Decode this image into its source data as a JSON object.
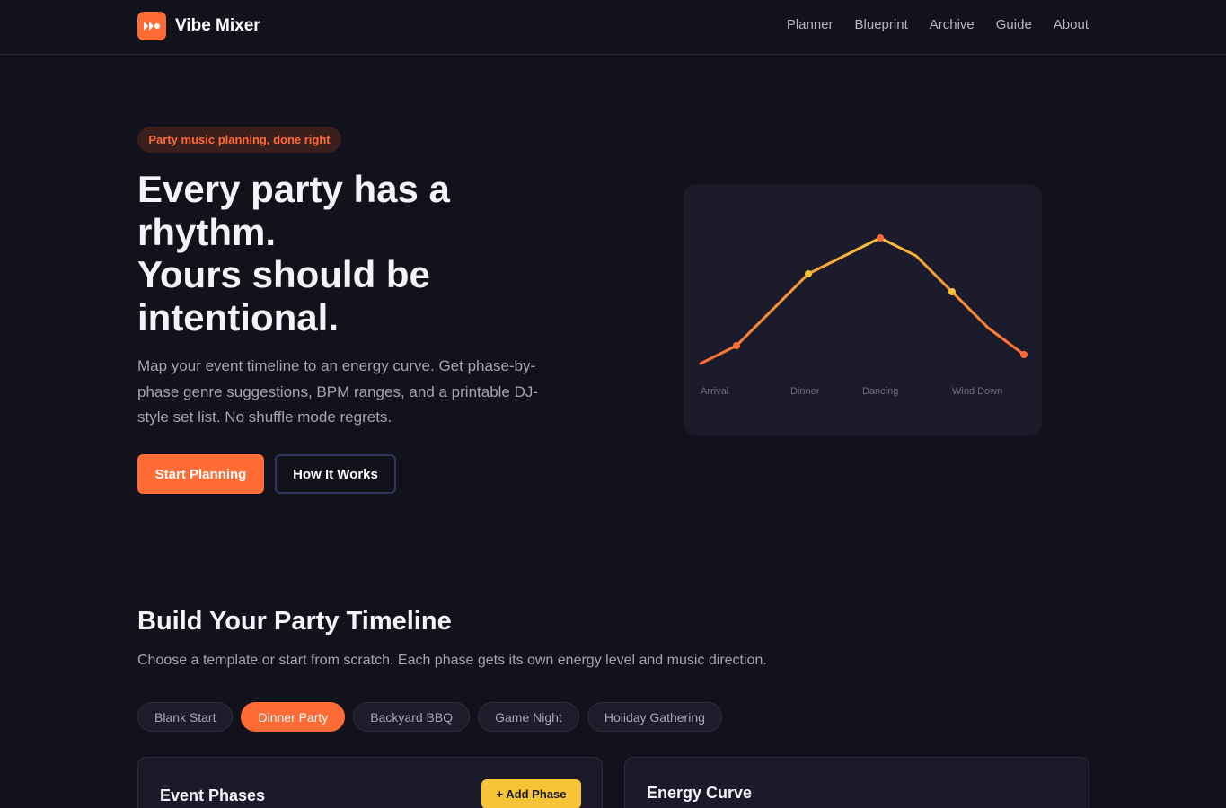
{
  "header": {
    "brand": "Vibe Mixer",
    "nav": [
      "Planner",
      "Blueprint",
      "Archive",
      "Guide",
      "About"
    ]
  },
  "hero": {
    "badge": "Party music planning, done right",
    "title_lines": [
      "Every party has a",
      "rhythm.",
      "Yours should be",
      "intentional."
    ],
    "description": "Map your event timeline to an energy curve. Get phase-by-phase genre suggestions, BPM ranges, and a printable DJ-style set list. No shuffle mode regrets.",
    "primary_button": "Start Planning",
    "secondary_button": "How It Works",
    "curve_labels": [
      "Arrival",
      "Dinner",
      "Dancing",
      "Wind Down"
    ]
  },
  "timeline": {
    "title": "Build Your Party Timeline",
    "description": "Choose a template or start from scratch. Each phase gets its own energy level and music direction.",
    "templates": [
      "Blank Start",
      "Dinner Party",
      "Backyard BBQ",
      "Game Night",
      "Holiday Gathering"
    ],
    "selected_template": "Dinner Party",
    "phases_panel": {
      "title": "Event Phases",
      "add_button": "+ Add Phase"
    },
    "energy_panel": {
      "title": "Energy Curve"
    }
  },
  "colors": {
    "accent": "#ff6b35",
    "highlight": "#f7c438",
    "background": "#12121c"
  },
  "icons": {
    "logo": "fast-forward-icon"
  }
}
